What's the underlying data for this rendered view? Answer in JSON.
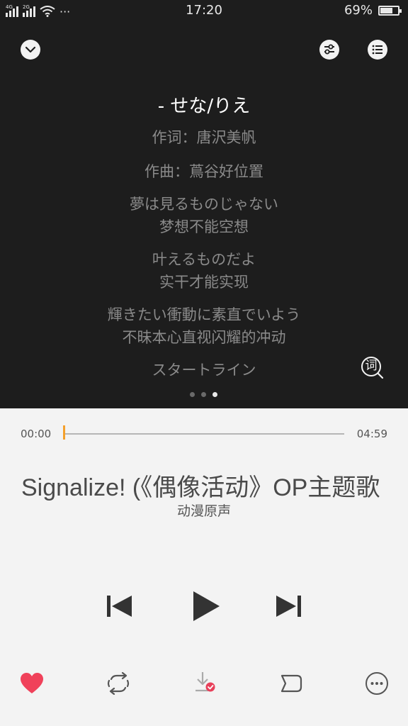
{
  "status_bar": {
    "net1": "4G",
    "net2": "2G",
    "more": "···",
    "time": "17:20",
    "battery_percent": "69%",
    "battery_level": 0.69
  },
  "header": {
    "collapse_icon": "chevron-down-icon",
    "equalizer_icon": "equalizer-icon",
    "playlist_icon": "playlist-icon"
  },
  "lyrics": {
    "title": "- せな/りえ",
    "lyricist": "作词：唐沢美帆",
    "composer": "作曲：蔦谷好位置",
    "lines": [
      "夢は見るものじゃない",
      "梦想不能空想",
      "叶えるものだよ",
      "实干才能实现",
      "輝きたい衝動に素直でいよう",
      "不昧本心直视闪耀的冲动",
      "スタートライン"
    ],
    "search_icon_label": "词",
    "page_dots": 3,
    "active_page": 3
  },
  "progress": {
    "current_time": "00:00",
    "total_time": "04:59",
    "fraction": 0.0
  },
  "song": {
    "title": "Signalize! (《偶像活动》OP主题歌",
    "artist": "动漫原声"
  },
  "controls": {
    "prev_icon": "skip-previous-icon",
    "play_icon": "play-icon",
    "next_icon": "skip-next-icon"
  },
  "bottom_bar": {
    "favorite_icon": "heart-icon",
    "repeat_icon": "repeat-icon",
    "download_icon": "download-icon",
    "share_icon": "share-icon",
    "more_icon": "more-icon",
    "favorite_color": "#f0415a",
    "download_badge_color": "#e8405a"
  },
  "colors": {
    "dark_background": "#1d1d1d",
    "light_background": "#f3f3f3",
    "progress_thumb": "#f4a02c"
  }
}
